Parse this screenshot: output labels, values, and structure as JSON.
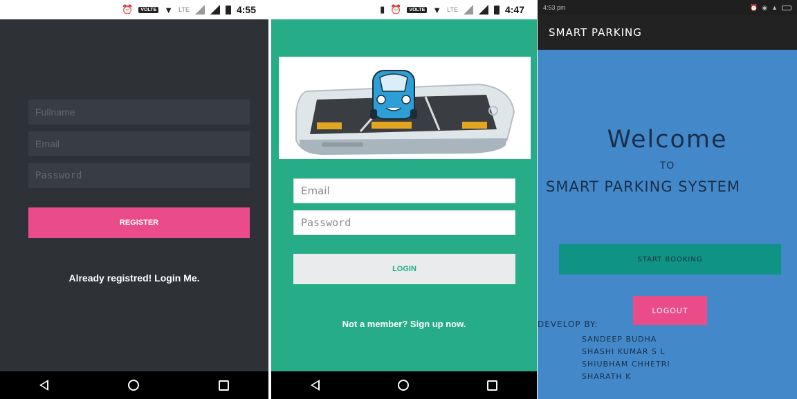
{
  "screen1": {
    "status": {
      "time": "4:55",
      "volte": "VOLTE",
      "lte": "LTE"
    },
    "fields": {
      "fullname_placeholder": "Fullname",
      "email_placeholder": "Email",
      "password_placeholder": "Password"
    },
    "register_label": "REGISTER",
    "login_link": "Already registred! Login Me.",
    "colors": {
      "background": "#2e3136",
      "accent": "#ea4c89"
    }
  },
  "screen2": {
    "status": {
      "time": "4:47",
      "volte": "VOLTE",
      "lte": "LTE"
    },
    "fields": {
      "email_placeholder": "Email",
      "password_placeholder": "Password"
    },
    "login_label": "LOGIN",
    "signup_link": "Not a member? Sign up now.",
    "colors": {
      "background": "#26ad88"
    }
  },
  "screen3": {
    "status": {
      "time": "4:53 pm"
    },
    "app_title": "SMART PARKING",
    "welcome": "Welcome",
    "to": "TO",
    "system_name": "SMART PARKING SYSTEM",
    "start_booking_label": "START BOOKING",
    "logout_label": "LOGOUT",
    "developers_title": "DEVELOP BY:",
    "developers": [
      "SANDEEP BUDHA",
      "SHASHI KUMAR S L",
      "SHIUBHAM CHHETRI",
      "SHARATH K"
    ],
    "colors": {
      "background": "#4389c9",
      "start": "#0f9384",
      "logout": "#ea4c89"
    }
  },
  "icons": [
    "alarm-icon",
    "wifi-icon",
    "signal-icon",
    "battery-icon",
    "vibrate-icon",
    "back-icon",
    "home-icon",
    "recents-icon",
    "car-phone-illustration"
  ]
}
